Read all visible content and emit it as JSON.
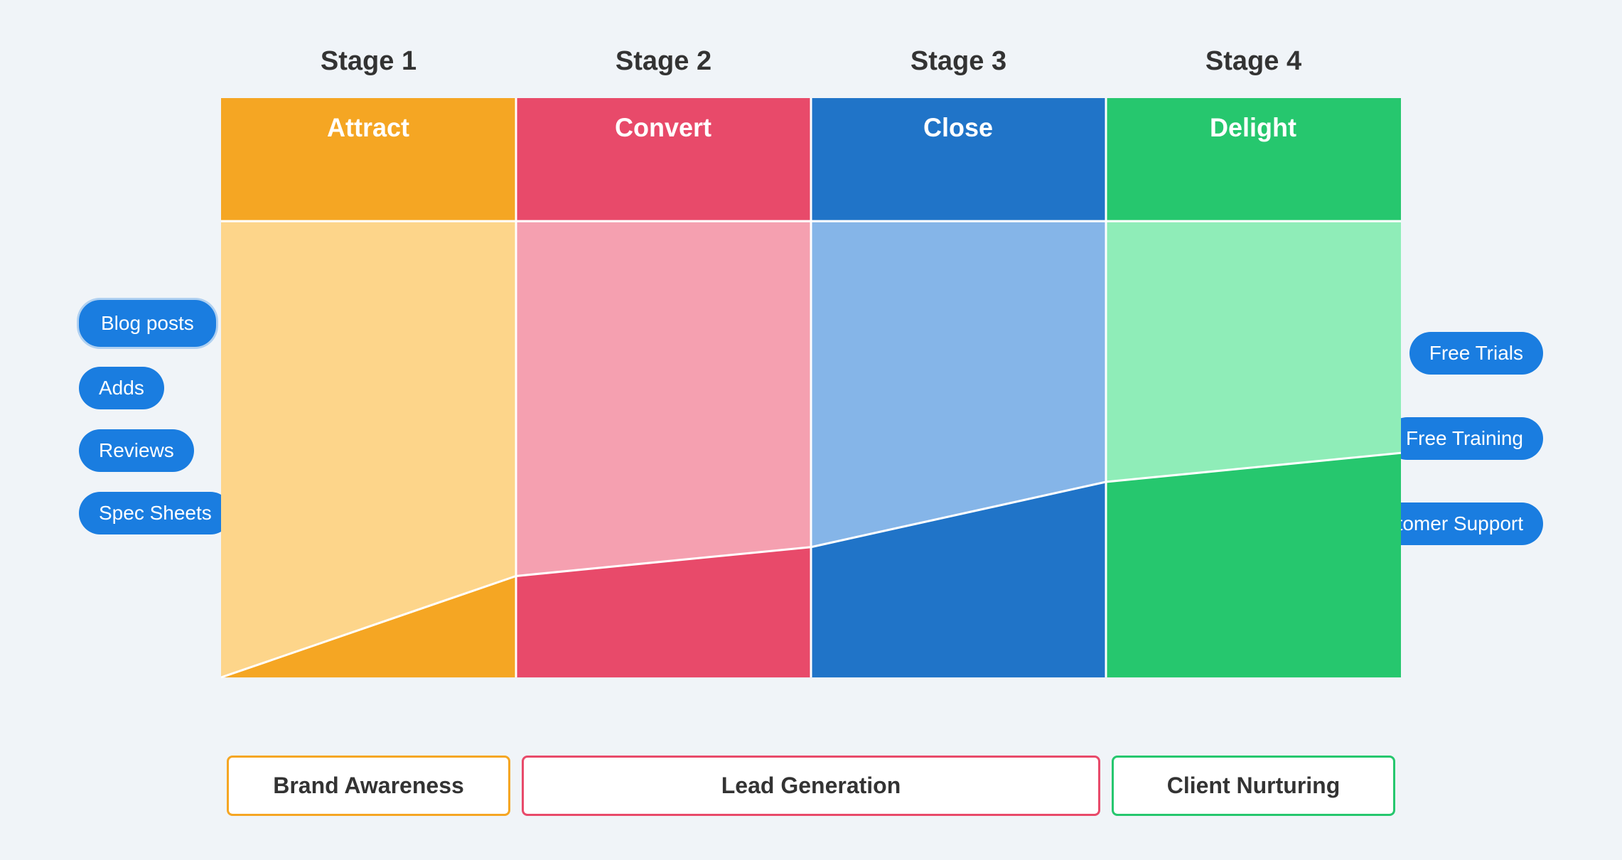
{
  "stages": [
    {
      "id": "attract",
      "label": "Attract",
      "stageNum": "Stage 1",
      "colorDark": "#f5a623",
      "colorLight": "#fdd58a",
      "labelBorderColor": "#f5a623"
    },
    {
      "id": "convert",
      "label": "Convert",
      "stageNum": "Stage 2",
      "colorDark": "#e84a6a",
      "colorLight": "#f5a0b0",
      "labelBorderColor": "#e84a6a"
    },
    {
      "id": "close",
      "label": "Close",
      "stageNum": "Stage 3",
      "colorDark": "#2074c8",
      "colorLight": "#85b5e8",
      "labelBorderColor": "#2074c8"
    },
    {
      "id": "delight",
      "label": "Delight",
      "stageNum": "Stage 4",
      "colorDark": "#26c76e",
      "colorLight": "#8fedb8",
      "labelBorderColor": "#26c76e"
    }
  ],
  "leftButtons": [
    {
      "label": "Blog posts",
      "active": true
    },
    {
      "label": "Adds",
      "active": false
    },
    {
      "label": "Reviews",
      "active": false
    },
    {
      "label": "Spec Sheets",
      "active": false
    }
  ],
  "rightButtons": [
    {
      "label": "Free Trials"
    },
    {
      "label": "Free Training"
    },
    {
      "label": "Customer Support"
    }
  ],
  "bottomLabels": [
    {
      "label": "Brand Awareness",
      "borderColor": "#f5a623",
      "span": 1
    },
    {
      "label": "Lead Generation",
      "borderColor": "#e84a6a",
      "span": 1
    },
    {
      "label": "Client Nurturing",
      "borderColor": "#26c76e",
      "span": 1
    }
  ]
}
